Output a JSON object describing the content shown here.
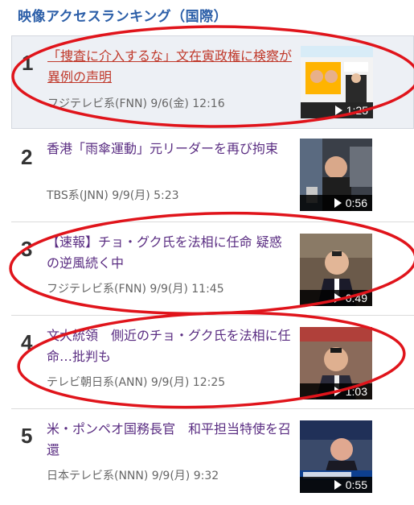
{
  "heading": "映像アクセスランキング（国際）",
  "items": [
    {
      "rank": "1",
      "title": "「捜査に介入するな」文在寅政権に検察が異例の声明",
      "meta": "フジテレビ系(FNN) 9/6(金) 12:16",
      "duration": "1:25"
    },
    {
      "rank": "2",
      "title": "香港「雨傘運動」元リーダーを再び拘束",
      "meta": "TBS系(JNN) 9/9(月) 5:23",
      "duration": "0:56"
    },
    {
      "rank": "3",
      "title": "【速報】チョ・グク氏を法相に任命 疑惑の逆風続く中",
      "meta": "フジテレビ系(FNN) 9/9(月) 11:45",
      "duration": "0:49"
    },
    {
      "rank": "4",
      "title": "文大統領　側近のチョ・グク氏を法相に任命…批判も",
      "meta": "テレビ朝日系(ANN) 9/9(月) 12:25",
      "duration": "1:03"
    },
    {
      "rank": "5",
      "title": "米・ポンペオ国務長官　和平担当特使を召還",
      "meta": "日本テレビ系(NNN) 9/9(月) 9:32",
      "duration": "0:55"
    }
  ],
  "annotation_color": "#e0141b"
}
